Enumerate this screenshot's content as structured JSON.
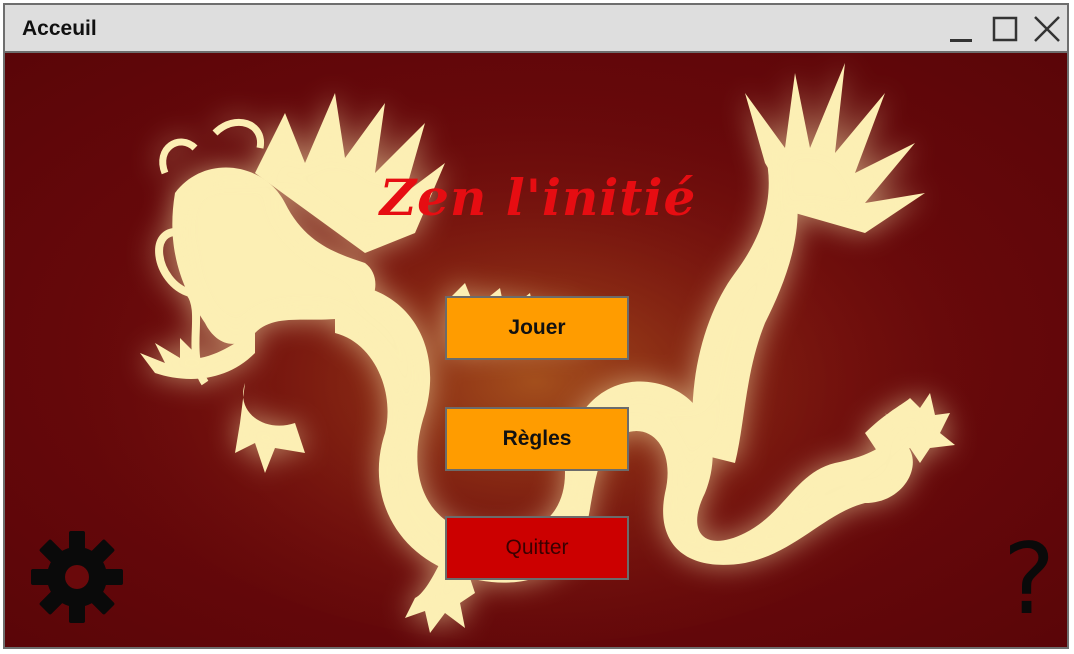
{
  "window": {
    "title": "Acceuil",
    "controls": [
      "minimize-icon",
      "maximize-icon",
      "close-icon"
    ]
  },
  "main": {
    "app_title": "Zen l'initié",
    "buttons": {
      "play": "Jouer",
      "rules": "Règles",
      "quit": "Quitter"
    },
    "settings_icon": "gear-icon",
    "help_label": "?"
  },
  "colors": {
    "background": "#6a090b",
    "title": "#e60d12",
    "primary_button": "#ff9c00",
    "quit_button": "#cc0000",
    "dragon": "#fcefb4"
  }
}
